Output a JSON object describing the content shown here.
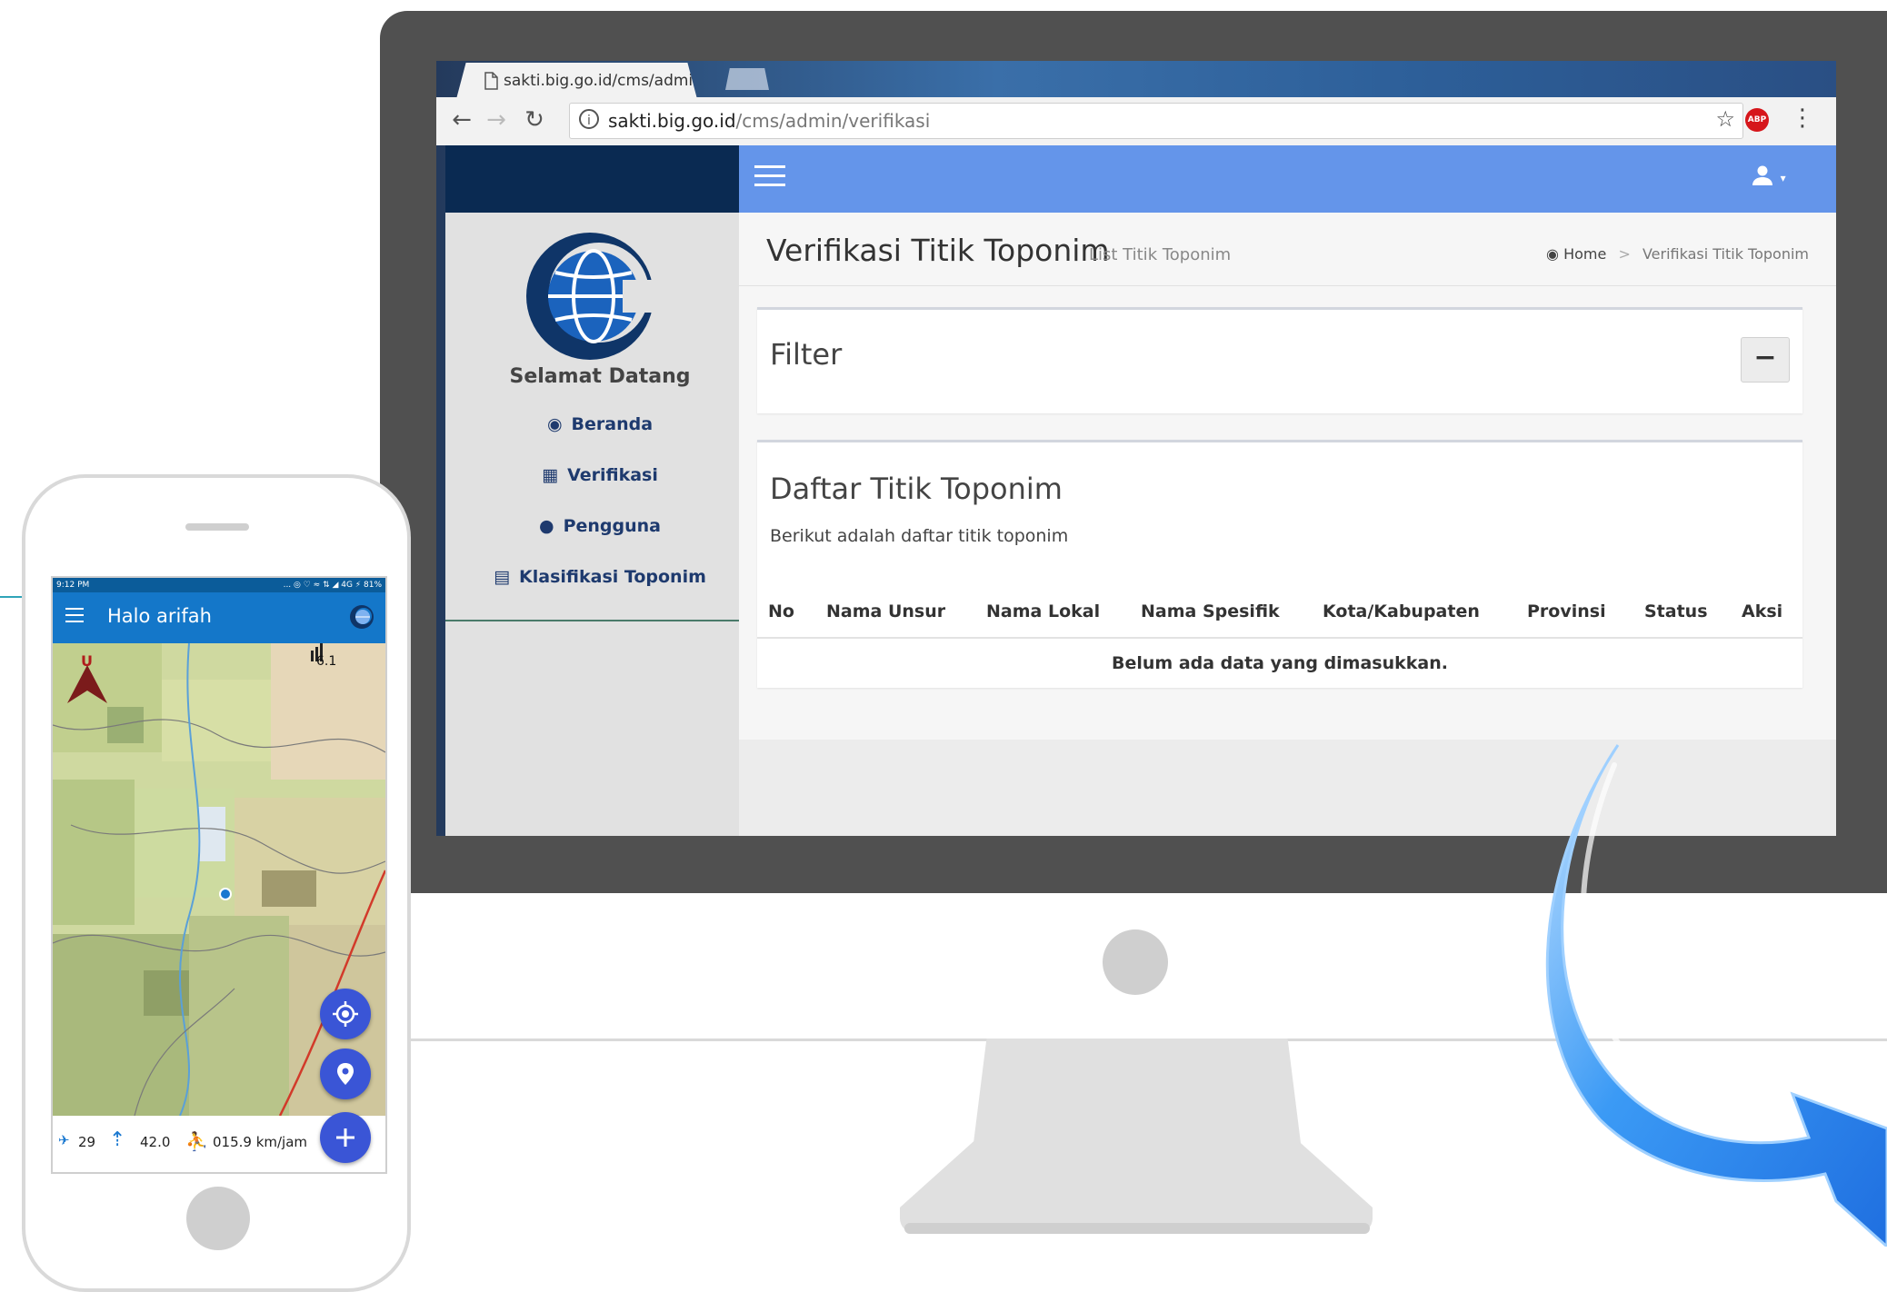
{
  "browser": {
    "tab_title": "sakti.big.go.id/cms/admi",
    "tab_close": "×",
    "url_host": "sakti.big.go.id",
    "url_path": "/cms/admin/verifikasi",
    "abp_label": "ABP"
  },
  "sidebar": {
    "welcome": "Selamat Datang",
    "items": [
      {
        "label": "Beranda",
        "icon": "dashboard-icon"
      },
      {
        "label": "Verifikasi",
        "icon": "table-icon"
      },
      {
        "label": "Pengguna",
        "icon": "user-icon"
      },
      {
        "label": "Klasifikasi Toponim",
        "icon": "list-icon"
      }
    ]
  },
  "page": {
    "title": "Verifikasi Titik Toponim",
    "subtitle": "List Titik Toponim",
    "breadcrumb": {
      "home": "Home",
      "separator": ">",
      "current": "Verifikasi Titik Toponim"
    }
  },
  "filter_box": {
    "title": "Filter",
    "collapse_label": "−"
  },
  "list_box": {
    "title": "Daftar Titik Toponim",
    "description": "Berikut adalah daftar titik toponim",
    "columns": [
      "No",
      "Nama Unsur",
      "Nama Lokal",
      "Nama Spesifik",
      "Kota/Kabupaten",
      "Provinsi",
      "Status",
      "Aksi"
    ],
    "empty_message": "Belum ada data yang dimasukkan."
  },
  "phone": {
    "status_time": "9:12 PM",
    "status_right": "... ◎ ♡ ≈ ⇅ ◢ 4G ⚡ 81%",
    "app_title": "Halo arifah",
    "compass_label": "U",
    "signal_value": "6.1",
    "satellites": "29",
    "altitude": "42.0",
    "speed": "015.9 km/jam"
  },
  "colors": {
    "topbar": "#6495ea",
    "logo_bar": "#0a2a52",
    "app_bar": "#1477c9",
    "fab": "#3a55d6",
    "arrow": "#2b8cf0"
  }
}
